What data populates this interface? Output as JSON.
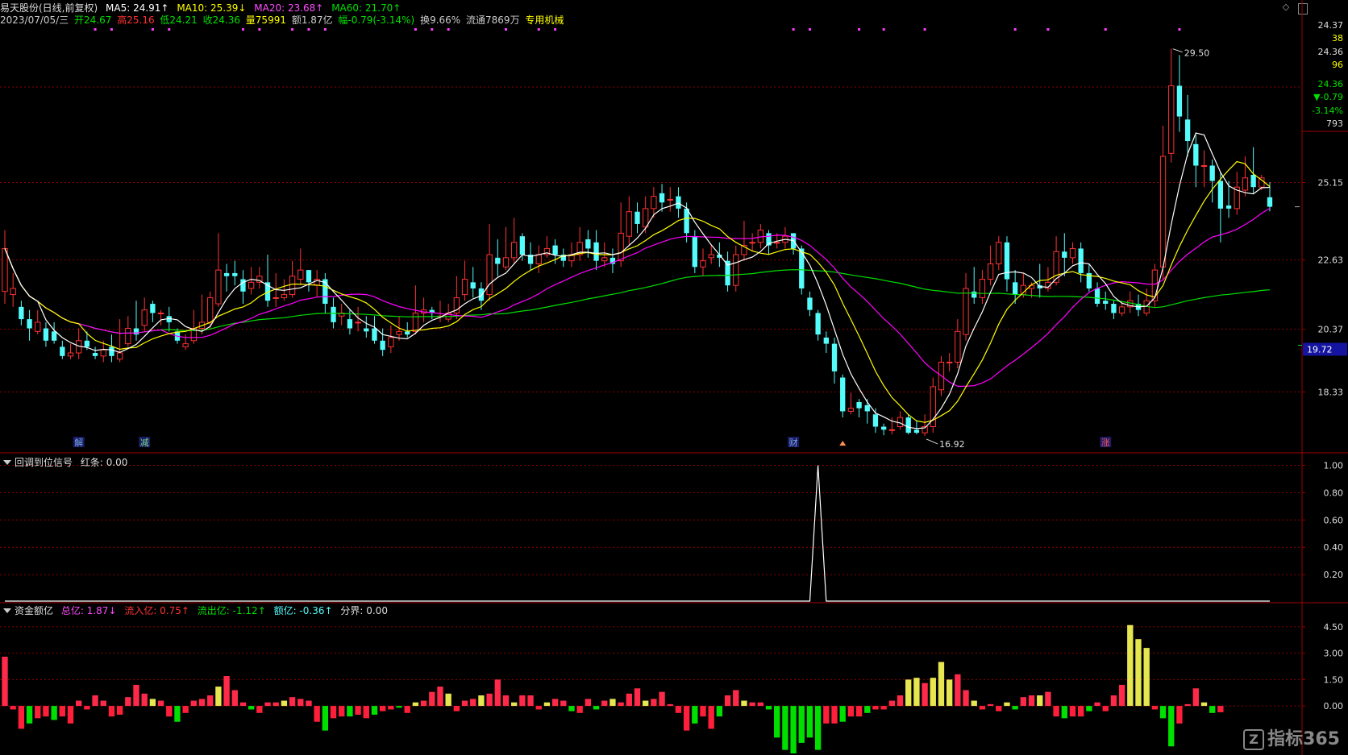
{
  "header": {
    "stock_name": "易天股份(日线,前复权)",
    "ma5": "MA5: 24.91↑",
    "ma10": "MA10: 25.39↓",
    "ma20": "MA20: 23.68↑",
    "ma60": "MA60: 21.70↑",
    "date": "2023/07/05/三",
    "open": "开24.67",
    "high": "高25.16",
    "low": "低24.21",
    "close": "收24.36",
    "volume": "量75991",
    "amount": "额1.87亿",
    "change": "幅-0.79(-3.14%)",
    "turnover": "换9.66%",
    "float": "流通7869万",
    "industry": "专用机械"
  },
  "info_box": {
    "price1": "24.37",
    "val1": "38",
    "price2": "24.36",
    "val2": "96",
    "price3": "24.36",
    "change": "▼-0.79",
    "change_pct": "-3.14%",
    "vol": "793"
  },
  "indicator1": {
    "name": "回调到位信号",
    "value": "红条: 0.00"
  },
  "indicator2": {
    "name": "资金额亿",
    "total": "总亿: 1.87↓",
    "inflow": "流入亿: 0.75↑",
    "outflow": "流出亿: -1.12↑",
    "net": "额亿: -0.36↑",
    "boundary": "分界: 0.00"
  },
  "markers": {
    "jie": "解",
    "jian": "减",
    "cai": "财",
    "zhang": "涨",
    "high_label": "29.50",
    "low_label": "16.92",
    "current_price_tag": "19.72"
  },
  "watermark": "指标365",
  "colors": {
    "up": "#ff3232",
    "down": "#54fcfc",
    "ma5": "#ffffff",
    "ma10": "#ffff00",
    "ma20": "#ff00ff",
    "ma60": "#00e000",
    "grid": "#8b0000"
  },
  "chart_data": [
    {
      "type": "candlestick",
      "title": "易天股份(日线,前复权)",
      "y_ticks": [
        18.33,
        20.37,
        22.63,
        25.15
      ],
      "ylim": [
        16.4,
        30.2
      ],
      "candles": [
        [
          21.6,
          23.0,
          21.2,
          23.6
        ],
        [
          21.5,
          21.7,
          21.1,
          22.2
        ],
        [
          21.1,
          20.7,
          20.5,
          21.3
        ],
        [
          20.7,
          20.4,
          20.0,
          21.0
        ],
        [
          20.3,
          20.6,
          20.2,
          21.0
        ],
        [
          20.4,
          20.0,
          19.8,
          20.6
        ],
        [
          20.3,
          20.0,
          19.9,
          20.6
        ],
        [
          19.8,
          19.5,
          19.4,
          20.0
        ],
        [
          19.5,
          19.6,
          19.4,
          19.9
        ],
        [
          19.6,
          20.0,
          19.4,
          20.4
        ],
        [
          20.0,
          19.8,
          19.7,
          20.3
        ],
        [
          19.6,
          19.5,
          19.4,
          19.8
        ],
        [
          19.5,
          19.7,
          19.3,
          20.0
        ],
        [
          19.8,
          19.5,
          19.3,
          20.2
        ],
        [
          19.4,
          19.6,
          19.3,
          20.7
        ],
        [
          19.9,
          20.4,
          19.8,
          20.8
        ],
        [
          20.4,
          20.2,
          20.0,
          21.3
        ],
        [
          20.5,
          21.0,
          20.3,
          21.4
        ],
        [
          21.2,
          20.9,
          20.6,
          21.3
        ],
        [
          20.9,
          20.9,
          20.5,
          21.0
        ],
        [
          20.8,
          20.6,
          20.3,
          21.1
        ],
        [
          20.3,
          20.0,
          19.9,
          20.4
        ],
        [
          19.8,
          19.9,
          19.7,
          20.2
        ],
        [
          20.0,
          20.4,
          19.9,
          21.0
        ],
        [
          20.4,
          20.6,
          20.2,
          21.5
        ],
        [
          20.6,
          21.4,
          20.4,
          21.6
        ],
        [
          21.2,
          22.3,
          21.1,
          23.5
        ],
        [
          22.2,
          22.1,
          21.6,
          22.5
        ],
        [
          22.2,
          22.1,
          21.8,
          22.6
        ],
        [
          22.0,
          21.6,
          21.2,
          22.3
        ],
        [
          21.7,
          21.9,
          21.5,
          22.4
        ],
        [
          21.9,
          22.1,
          21.7,
          22.4
        ],
        [
          21.9,
          21.3,
          21.1,
          22.8
        ],
        [
          21.4,
          21.4,
          21.1,
          22.2
        ],
        [
          21.4,
          21.5,
          21.3,
          22.0
        ],
        [
          21.5,
          22.1,
          21.4,
          22.6
        ],
        [
          22.0,
          22.3,
          21.8,
          23.0
        ],
        [
          22.3,
          21.9,
          21.6,
          22.3
        ],
        [
          21.8,
          22.0,
          21.4,
          22.3
        ],
        [
          22.0,
          21.2,
          20.9,
          22.2
        ],
        [
          21.1,
          20.6,
          20.4,
          21.4
        ],
        [
          20.8,
          20.9,
          20.5,
          21.2
        ],
        [
          20.7,
          20.4,
          20.2,
          21.0
        ],
        [
          20.6,
          20.6,
          20.3,
          21.1
        ],
        [
          20.4,
          20.3,
          20.1,
          20.8
        ],
        [
          20.4,
          20.0,
          19.9,
          20.8
        ],
        [
          20.0,
          19.7,
          19.5,
          20.4
        ],
        [
          19.8,
          20.1,
          19.6,
          20.5
        ],
        [
          20.2,
          20.3,
          20.0,
          20.8
        ],
        [
          20.3,
          20.2,
          20.1,
          20.6
        ],
        [
          20.3,
          20.9,
          20.2,
          21.8
        ],
        [
          20.9,
          21.0,
          20.6,
          21.4
        ],
        [
          21.0,
          20.9,
          20.7,
          21.1
        ],
        [
          20.8,
          20.8,
          20.6,
          21.3
        ],
        [
          20.7,
          20.9,
          20.6,
          21.2
        ],
        [
          20.9,
          21.4,
          20.7,
          22.1
        ],
        [
          21.5,
          22.0,
          21.3,
          22.6
        ],
        [
          21.9,
          21.7,
          21.4,
          22.4
        ],
        [
          21.7,
          21.3,
          21.0,
          21.9
        ],
        [
          21.5,
          22.8,
          21.3,
          23.8
        ],
        [
          22.7,
          22.5,
          22.1,
          23.3
        ],
        [
          22.4,
          22.7,
          22.3,
          23.7
        ],
        [
          22.7,
          23.2,
          22.5,
          24.0
        ],
        [
          23.4,
          22.8,
          22.6,
          23.5
        ],
        [
          22.8,
          22.5,
          22.3,
          23.2
        ],
        [
          22.5,
          22.8,
          22.2,
          23.1
        ],
        [
          22.8,
          23.0,
          22.7,
          23.4
        ],
        [
          23.1,
          22.8,
          22.5,
          23.3
        ],
        [
          22.8,
          22.6,
          22.4,
          23.0
        ],
        [
          22.6,
          22.8,
          22.4,
          23.2
        ],
        [
          22.8,
          23.2,
          22.6,
          23.7
        ],
        [
          23.3,
          23.0,
          22.7,
          23.6
        ],
        [
          23.2,
          22.6,
          22.3,
          23.6
        ],
        [
          22.6,
          22.7,
          22.4,
          23.2
        ],
        [
          22.7,
          22.5,
          22.2,
          23.0
        ],
        [
          22.6,
          23.5,
          22.4,
          24.5
        ],
        [
          23.4,
          24.2,
          23.1,
          24.7
        ],
        [
          24.2,
          23.8,
          23.5,
          24.5
        ],
        [
          23.7,
          24.3,
          23.5,
          24.7
        ],
        [
          24.3,
          24.7,
          24.0,
          25.0
        ],
        [
          24.8,
          24.5,
          24.2,
          25.1
        ],
        [
          24.6,
          24.6,
          24.2,
          25.0
        ],
        [
          24.7,
          24.3,
          24.0,
          25.0
        ],
        [
          24.3,
          23.5,
          23.2,
          24.5
        ],
        [
          23.4,
          22.4,
          22.2,
          23.6
        ],
        [
          22.4,
          22.6,
          22.1,
          23.0
        ],
        [
          22.7,
          22.8,
          22.5,
          23.1
        ],
        [
          22.8,
          22.7,
          22.4,
          23.2
        ],
        [
          22.6,
          21.8,
          21.6,
          22.9
        ],
        [
          21.8,
          22.8,
          21.6,
          23.1
        ],
        [
          22.8,
          23.1,
          22.6,
          23.9
        ],
        [
          23.2,
          23.2,
          22.9,
          23.5
        ],
        [
          23.2,
          23.6,
          23.0,
          23.8
        ],
        [
          23.5,
          23.1,
          22.8,
          23.6
        ],
        [
          23.2,
          23.2,
          23.0,
          23.5
        ],
        [
          23.2,
          23.4,
          23.0,
          23.7
        ],
        [
          23.5,
          23.0,
          22.8,
          23.5
        ],
        [
          23.0,
          21.7,
          21.5,
          23.1
        ],
        [
          21.4,
          21.0,
          20.8,
          21.6
        ],
        [
          20.9,
          20.2,
          20.0,
          21.0
        ],
        [
          20.1,
          19.9,
          19.6,
          20.3
        ],
        [
          19.9,
          19.0,
          18.6,
          20.1
        ],
        [
          18.8,
          17.7,
          17.5,
          18.9
        ],
        [
          17.7,
          17.8,
          17.6,
          18.3
        ],
        [
          18.0,
          17.8,
          17.5,
          18.1
        ],
        [
          17.9,
          17.7,
          17.3,
          18.1
        ],
        [
          17.6,
          17.2,
          17.0,
          17.8
        ],
        [
          17.2,
          17.1,
          16.92,
          17.3
        ],
        [
          17.1,
          17.1,
          16.95,
          17.5
        ],
        [
          17.2,
          17.5,
          17.1,
          17.7
        ],
        [
          17.5,
          17.0,
          16.95,
          17.6
        ],
        [
          17.1,
          17.0,
          16.95,
          17.4
        ],
        [
          17.0,
          17.2,
          16.9,
          17.6
        ],
        [
          17.2,
          18.5,
          17.0,
          18.8
        ],
        [
          18.4,
          19.3,
          18.2,
          19.5
        ],
        [
          19.3,
          19.3,
          19.0,
          19.6
        ],
        [
          19.3,
          20.3,
          19.1,
          20.7
        ],
        [
          20.2,
          21.7,
          20.0,
          22.2
        ],
        [
          21.6,
          21.4,
          21.2,
          22.4
        ],
        [
          21.4,
          22.0,
          21.2,
          22.3
        ],
        [
          22.0,
          22.5,
          21.8,
          23.1
        ],
        [
          22.5,
          23.2,
          22.3,
          23.4
        ],
        [
          23.2,
          22.0,
          21.6,
          23.4
        ],
        [
          21.9,
          21.5,
          21.2,
          22.3
        ],
        [
          21.5,
          21.8,
          21.4,
          22.2
        ],
        [
          21.7,
          21.8,
          21.4,
          21.9
        ],
        [
          21.8,
          21.7,
          21.4,
          22.5
        ],
        [
          21.7,
          21.9,
          21.6,
          22.4
        ],
        [
          21.9,
          22.9,
          21.8,
          23.4
        ],
        [
          22.9,
          22.7,
          22.1,
          23.5
        ],
        [
          22.7,
          23.0,
          22.5,
          23.2
        ],
        [
          23.0,
          22.2,
          21.9,
          23.2
        ],
        [
          22.2,
          21.7,
          21.6,
          22.5
        ],
        [
          21.7,
          21.2,
          21.1,
          21.9
        ],
        [
          21.3,
          21.2,
          21.0,
          21.6
        ],
        [
          21.2,
          20.9,
          20.7,
          21.3
        ],
        [
          20.9,
          21.1,
          20.8,
          21.3
        ],
        [
          21.1,
          21.3,
          20.9,
          21.6
        ],
        [
          21.2,
          21.0,
          20.8,
          21.5
        ],
        [
          20.9,
          21.3,
          20.8,
          21.7
        ],
        [
          21.3,
          22.3,
          21.1,
          22.5
        ],
        [
          22.4,
          26.0,
          22.0,
          27.0
        ],
        [
          26.1,
          28.3,
          25.8,
          29.5
        ],
        [
          28.3,
          27.3,
          26.8,
          29.3
        ],
        [
          27.2,
          26.5,
          26.0,
          28.0
        ],
        [
          26.4,
          25.7,
          25.0,
          26.7
        ],
        [
          25.7,
          25.7,
          25.0,
          26.2
        ],
        [
          25.7,
          25.2,
          24.5,
          25.9
        ],
        [
          25.2,
          24.3,
          23.2,
          25.5
        ],
        [
          24.4,
          24.3,
          24.0,
          25.2
        ],
        [
          24.3,
          25.0,
          24.1,
          25.5
        ],
        [
          24.9,
          25.3,
          24.7,
          26.0
        ],
        [
          25.4,
          25.0,
          24.8,
          26.3
        ],
        [
          25.0,
          25.3,
          24.9,
          25.4
        ],
        [
          24.67,
          24.36,
          24.21,
          25.16
        ]
      ],
      "ma5_last": 24.91,
      "ma10_last": 25.39,
      "ma20_last": 23.68,
      "ma60_last": 21.7
    },
    {
      "type": "line",
      "title": "回调到位信号",
      "y_ticks": [
        0.2,
        0.4,
        0.6,
        0.8,
        1.0
      ],
      "ylim": [
        0,
        1.05
      ],
      "series": [
        {
          "name": "红条",
          "spike_index": 99,
          "spike_value": 1.0
        }
      ]
    },
    {
      "type": "bar",
      "title": "资金额亿",
      "y_ticks": [
        0.0,
        1.5,
        3.0,
        4.5
      ],
      "ylim": [
        -2.7,
        5.0
      ],
      "values": [
        2.8,
        -0.2,
        -1.3,
        -1.0,
        -0.7,
        -0.6,
        -0.8,
        -0.6,
        -1.0,
        0.3,
        -0.2,
        0.6,
        0.3,
        -0.6,
        -0.5,
        0.5,
        1.2,
        0.7,
        0.4,
        0.3,
        -0.6,
        -0.9,
        -0.4,
        0.3,
        0.4,
        0.6,
        1.1,
        1.7,
        0.9,
        0.2,
        -0.2,
        -0.4,
        0.2,
        0.2,
        0.3,
        0.5,
        0.4,
        0.3,
        -0.9,
        -1.4,
        -0.7,
        -0.6,
        -0.6,
        -0.5,
        -0.7,
        -0.5,
        -0.3,
        -0.2,
        -0.1,
        -0.4,
        0.2,
        0.3,
        0.8,
        1.1,
        0.7,
        -0.3,
        0.3,
        0.4,
        0.6,
        0.7,
        1.5,
        0.6,
        0.2,
        0.6,
        0.6,
        -0.2,
        0.2,
        0.4,
        0.3,
        -0.3,
        -0.4,
        0.4,
        -0.2,
        0.3,
        0.4,
        0.2,
        0.7,
        1.0,
        0.3,
        0.4,
        0.8,
        0.1,
        -0.4,
        -1.4,
        -1.0,
        -0.6,
        -1.3,
        -0.6,
        0.6,
        0.9,
        0.3,
        0.2,
        0.2,
        -0.2,
        -1.8,
        -2.5,
        -2.7,
        -2.1,
        -1.8,
        -2.5,
        -1.0,
        -1.0,
        -0.9,
        -0.6,
        -0.6,
        -0.4,
        -0.2,
        -0.2,
        0.3,
        0.6,
        1.5,
        1.6,
        1.3,
        1.6,
        2.5,
        1.5,
        1.8,
        0.9,
        0.3,
        -0.2,
        0.1,
        -0.3,
        0.2,
        -0.2,
        0.5,
        0.6,
        0.6,
        0.8,
        -0.6,
        -0.7,
        -0.6,
        -0.6,
        -0.3,
        0.2,
        -0.3,
        0.6,
        1.2,
        4.6,
        3.8,
        3.3,
        -0.2,
        -0.7,
        -2.3,
        -1.0,
        0.1,
        1.0,
        0.2,
        -0.4,
        -0.36
      ]
    }
  ]
}
